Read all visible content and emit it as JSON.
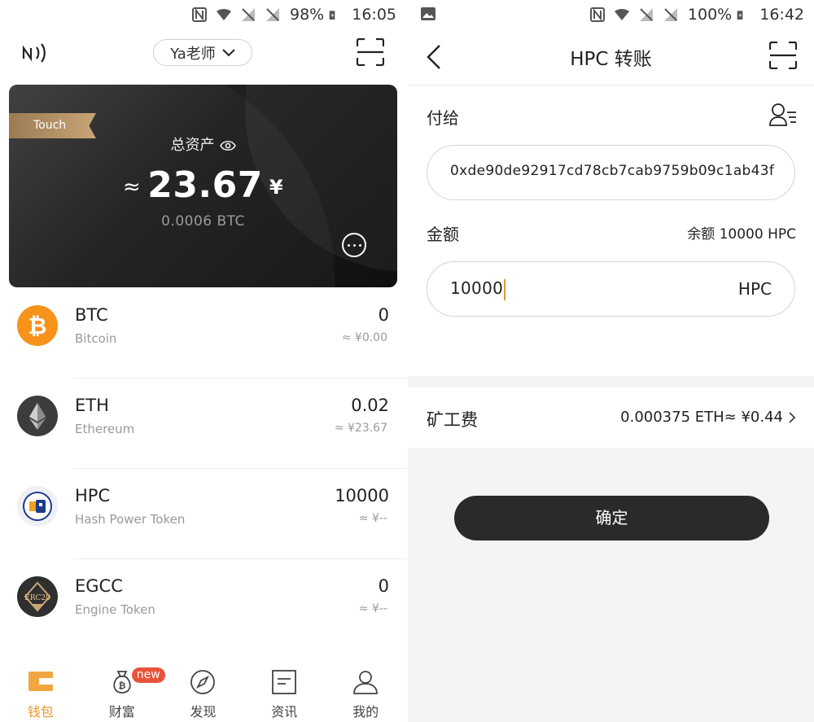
{
  "left": {
    "status": {
      "battery": "98%",
      "time": "16:05"
    },
    "user_name": "Ya老师",
    "card": {
      "badge": "Touch",
      "total_label": "总资产",
      "approx": "≈",
      "total_value": "23.67",
      "currency": "¥",
      "btc_value": "0.0006 BTC"
    },
    "coins": [
      {
        "symbol": "BTC",
        "name": "Bitcoin",
        "balance": "0",
        "fiat": "≈ ¥0.00",
        "icon": "bitcoin-icon",
        "color": "#f7931a"
      },
      {
        "symbol": "ETH",
        "name": "Ethereum",
        "balance": "0.02",
        "fiat": "≈ ¥23.67",
        "icon": "ethereum-icon",
        "color": "#3c3c3d"
      },
      {
        "symbol": "HPC",
        "name": "Hash Power Token",
        "balance": "10000",
        "fiat": "≈ ¥--",
        "icon": "hpc-icon",
        "color": "#1e3c8c"
      },
      {
        "symbol": "EGCC",
        "name": "Engine Token",
        "balance": "0",
        "fiat": "≈ ¥--",
        "icon": "erc20-icon",
        "color": "#2f2f2f"
      }
    ],
    "nav": [
      {
        "label": "钱包",
        "icon": "wallet-icon",
        "active": true
      },
      {
        "label": "财富",
        "icon": "money-bag-icon",
        "badge": "new"
      },
      {
        "label": "发现",
        "icon": "compass-icon"
      },
      {
        "label": "资讯",
        "icon": "news-icon"
      },
      {
        "label": "我的",
        "icon": "profile-icon"
      }
    ]
  },
  "right": {
    "status": {
      "battery": "100%",
      "time": "16:42"
    },
    "title": "HPC 转账",
    "pay_to_label": "付给",
    "address": "0xde90de92917cd78cb7cab9759b09c1ab43f",
    "amount_label": "金额",
    "balance_label": "余额 10000 HPC",
    "amount_value": "10000",
    "amount_unit": "HPC",
    "fee_label": "矿工费",
    "fee_value": "0.000375 ETH≈ ¥0.44",
    "confirm_label": "确定"
  },
  "colors": {
    "accent": "#e8962a",
    "badge": "#e9533b",
    "card_dark": "#1c1c1c",
    "gold": "#c9a577"
  }
}
